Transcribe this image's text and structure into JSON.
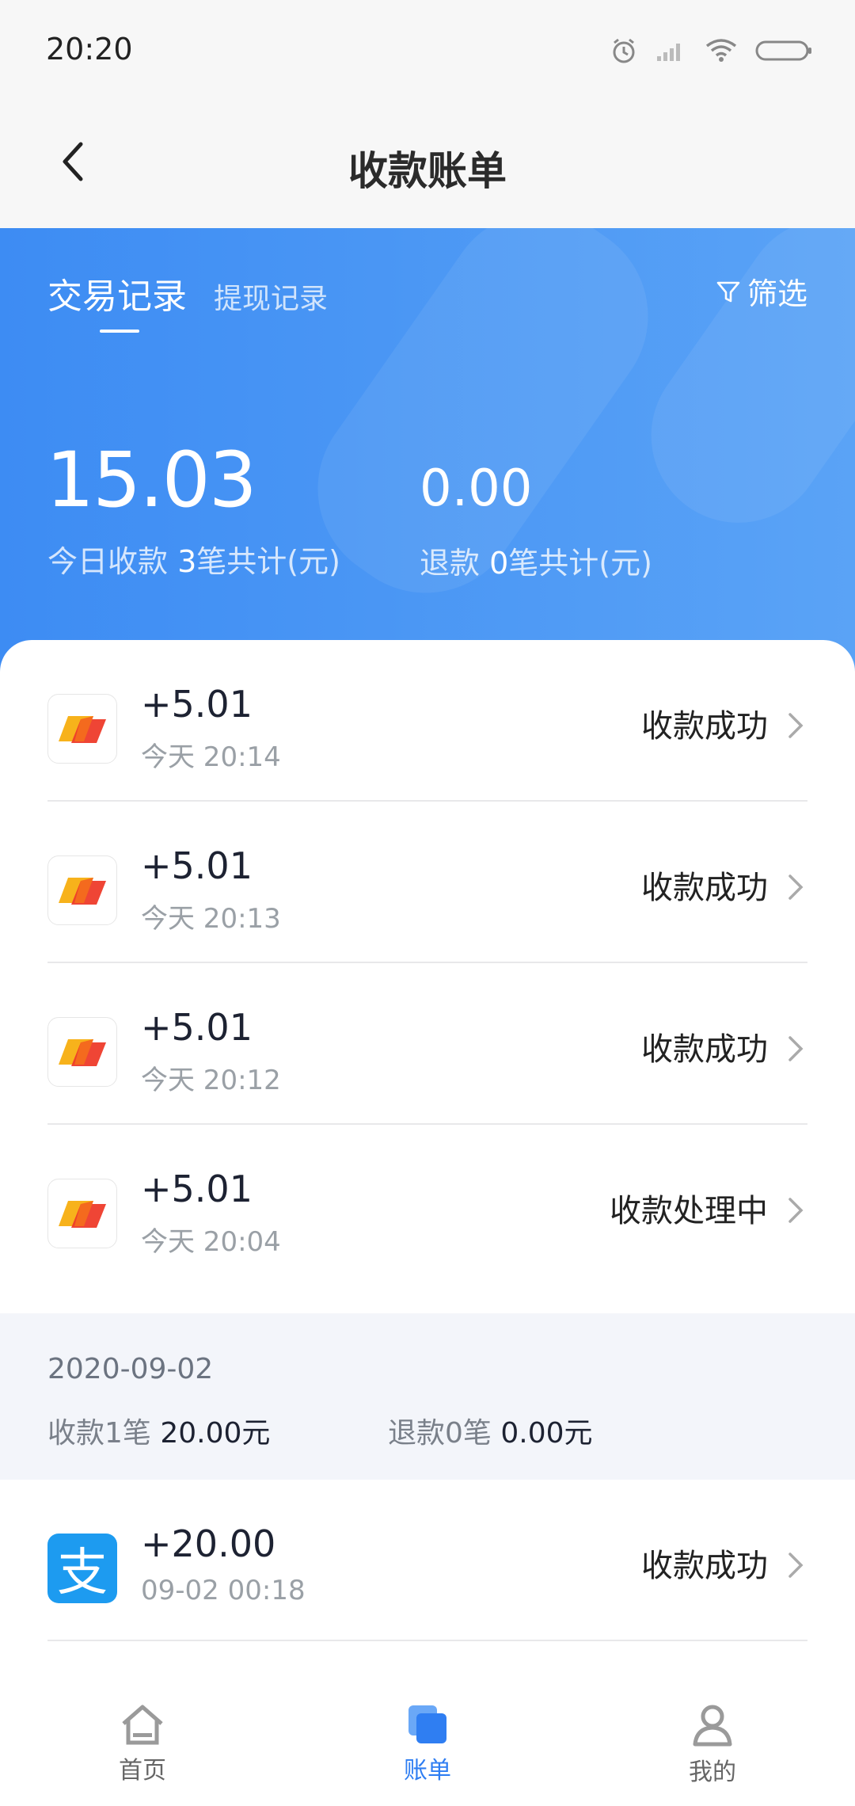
{
  "status_bar": {
    "time": "20:20"
  },
  "nav": {
    "title": "收款账单"
  },
  "tabs": {
    "active": "交易记录",
    "inactive": "提现记录",
    "filter": "筛选"
  },
  "summary": {
    "today_amount": "15.03",
    "today_label_prefix": "今日收款 ",
    "today_count": "3",
    "today_label_suffix": "笔共计(元)",
    "refund_amount": "0.00",
    "refund_label_prefix": "退款 ",
    "refund_count": "0",
    "refund_label_suffix": "笔共计(元)"
  },
  "transactions": [
    {
      "amount": "+5.01",
      "time": "今天 20:14",
      "status": "收款成功",
      "icon": "card-pay-icon"
    },
    {
      "amount": "+5.01",
      "time": "今天 20:13",
      "status": "收款成功",
      "icon": "card-pay-icon"
    },
    {
      "amount": "+5.01",
      "time": "今天 20:12",
      "status": "收款成功",
      "icon": "card-pay-icon"
    },
    {
      "amount": "+5.01",
      "time": "今天 20:04",
      "status": "收款处理中",
      "icon": "card-pay-icon"
    }
  ],
  "group": {
    "date": "2020-09-02",
    "income_label": "收款1笔 ",
    "income_amount": "20.00元",
    "refund_label": "退款0笔 ",
    "refund_amount": "0.00元",
    "transactions": [
      {
        "amount": "+20.00",
        "time": "09-02 00:18",
        "status": "收款成功",
        "icon": "alipay-icon",
        "glyph": "支"
      }
    ]
  },
  "tabbar": {
    "home": "首页",
    "bill": "账单",
    "mine": "我的"
  },
  "colors": {
    "accent": "#3d8cf3",
    "tab_active": "#2f7ef2"
  }
}
